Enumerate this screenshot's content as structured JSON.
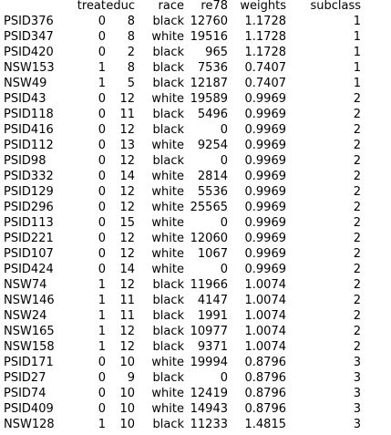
{
  "columns": {
    "rowname": "",
    "treat": "treat",
    "educ": "educ",
    "race": "race",
    "re78": "re78",
    "weights": "weights",
    "subclass": "subclass"
  },
  "rows": [
    {
      "id": "PSID376",
      "treat": "0",
      "educ": "8",
      "race": "black",
      "re78": "12760",
      "weights": "1.1728",
      "subclass": "1"
    },
    {
      "id": "PSID347",
      "treat": "0",
      "educ": "8",
      "race": "white",
      "re78": "19516",
      "weights": "1.1728",
      "subclass": "1"
    },
    {
      "id": "PSID420",
      "treat": "0",
      "educ": "2",
      "race": "black",
      "re78": "965",
      "weights": "1.1728",
      "subclass": "1"
    },
    {
      "id": "NSW153",
      "treat": "1",
      "educ": "8",
      "race": "black",
      "re78": "7536",
      "weights": "0.7407",
      "subclass": "1"
    },
    {
      "id": "NSW49",
      "treat": "1",
      "educ": "5",
      "race": "black",
      "re78": "12187",
      "weights": "0.7407",
      "subclass": "1"
    },
    {
      "id": "PSID43",
      "treat": "0",
      "educ": "12",
      "race": "white",
      "re78": "19589",
      "weights": "0.9969",
      "subclass": "2"
    },
    {
      "id": "PSID118",
      "treat": "0",
      "educ": "11",
      "race": "black",
      "re78": "5496",
      "weights": "0.9969",
      "subclass": "2"
    },
    {
      "id": "PSID416",
      "treat": "0",
      "educ": "12",
      "race": "black",
      "re78": "0",
      "weights": "0.9969",
      "subclass": "2"
    },
    {
      "id": "PSID112",
      "treat": "0",
      "educ": "13",
      "race": "white",
      "re78": "9254",
      "weights": "0.9969",
      "subclass": "2"
    },
    {
      "id": "PSID98",
      "treat": "0",
      "educ": "12",
      "race": "black",
      "re78": "0",
      "weights": "0.9969",
      "subclass": "2"
    },
    {
      "id": "PSID332",
      "treat": "0",
      "educ": "14",
      "race": "white",
      "re78": "2814",
      "weights": "0.9969",
      "subclass": "2"
    },
    {
      "id": "PSID129",
      "treat": "0",
      "educ": "12",
      "race": "white",
      "re78": "5536",
      "weights": "0.9969",
      "subclass": "2"
    },
    {
      "id": "PSID296",
      "treat": "0",
      "educ": "12",
      "race": "white",
      "re78": "25565",
      "weights": "0.9969",
      "subclass": "2"
    },
    {
      "id": "PSID113",
      "treat": "0",
      "educ": "15",
      "race": "white",
      "re78": "0",
      "weights": "0.9969",
      "subclass": "2"
    },
    {
      "id": "PSID221",
      "treat": "0",
      "educ": "12",
      "race": "white",
      "re78": "12060",
      "weights": "0.9969",
      "subclass": "2"
    },
    {
      "id": "PSID107",
      "treat": "0",
      "educ": "12",
      "race": "white",
      "re78": "1067",
      "weights": "0.9969",
      "subclass": "2"
    },
    {
      "id": "PSID424",
      "treat": "0",
      "educ": "14",
      "race": "white",
      "re78": "0",
      "weights": "0.9969",
      "subclass": "2"
    },
    {
      "id": "NSW74",
      "treat": "1",
      "educ": "12",
      "race": "black",
      "re78": "11966",
      "weights": "1.0074",
      "subclass": "2"
    },
    {
      "id": "NSW146",
      "treat": "1",
      "educ": "11",
      "race": "black",
      "re78": "4147",
      "weights": "1.0074",
      "subclass": "2"
    },
    {
      "id": "NSW24",
      "treat": "1",
      "educ": "11",
      "race": "black",
      "re78": "1991",
      "weights": "1.0074",
      "subclass": "2"
    },
    {
      "id": "NSW165",
      "treat": "1",
      "educ": "12",
      "race": "black",
      "re78": "10977",
      "weights": "1.0074",
      "subclass": "2"
    },
    {
      "id": "NSW158",
      "treat": "1",
      "educ": "12",
      "race": "black",
      "re78": "9371",
      "weights": "1.0074",
      "subclass": "2"
    },
    {
      "id": "PSID171",
      "treat": "0",
      "educ": "10",
      "race": "white",
      "re78": "19994",
      "weights": "0.8796",
      "subclass": "3"
    },
    {
      "id": "PSID27",
      "treat": "0",
      "educ": "9",
      "race": "black",
      "re78": "0",
      "weights": "0.8796",
      "subclass": "3"
    },
    {
      "id": "PSID74",
      "treat": "0",
      "educ": "10",
      "race": "white",
      "re78": "12419",
      "weights": "0.8796",
      "subclass": "3"
    },
    {
      "id": "PSID409",
      "treat": "0",
      "educ": "10",
      "race": "white",
      "re78": "14943",
      "weights": "0.8796",
      "subclass": "3"
    },
    {
      "id": "NSW128",
      "treat": "1",
      "educ": "10",
      "race": "black",
      "re78": "11233",
      "weights": "1.4815",
      "subclass": "3"
    }
  ]
}
